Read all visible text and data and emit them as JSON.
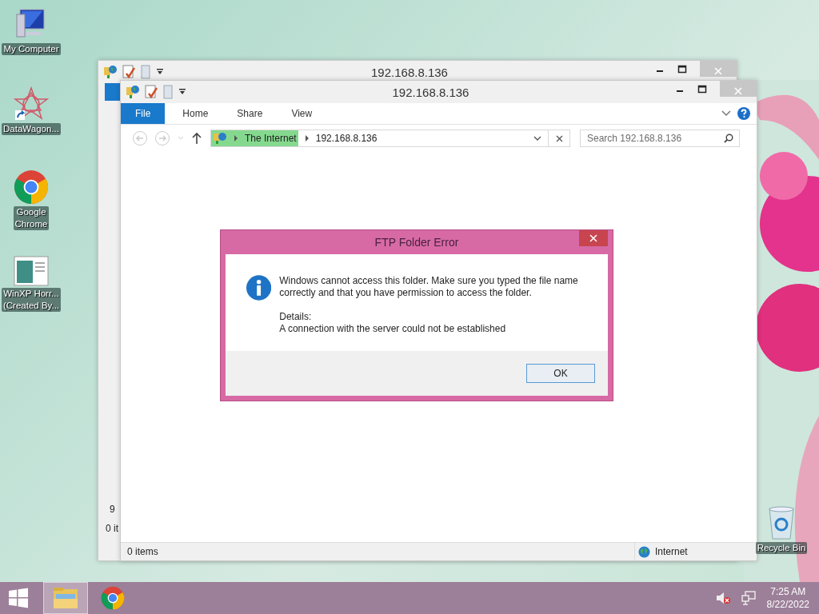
{
  "desktop_icons": [
    {
      "kind": "computer",
      "lines": [
        "My Computer"
      ]
    },
    {
      "kind": "star",
      "lines": [
        "DataWagon..."
      ]
    },
    {
      "kind": "chrome",
      "lines": [
        "Google",
        "Chrome"
      ]
    },
    {
      "kind": "document",
      "lines": [
        "WinXP Horr...",
        "(Created By..."
      ]
    }
  ],
  "recycle_bin": {
    "label": "Recycle Bin"
  },
  "back_window": {
    "title": "192.168.8.136",
    "text_1": "9",
    "status": "0 it"
  },
  "window": {
    "title": "192.168.8.136",
    "ribbon_tabs": [
      {
        "label": "File",
        "selected": true
      },
      {
        "label": "Home",
        "selected": false
      },
      {
        "label": "Share",
        "selected": false
      },
      {
        "label": "View",
        "selected": false
      }
    ],
    "breadcrumb": [
      "The Internet",
      "192.168.8.136"
    ],
    "search": {
      "placeholder": "Search 192.168.8.136"
    },
    "status_bar": {
      "items": "0 items",
      "zone": "Internet"
    }
  },
  "dialog": {
    "title": "FTP Folder Error",
    "message": "Windows cannot access this folder. Make sure you typed the file name correctly and that you have permission to access the folder.",
    "details_label": "Details:",
    "details": "A connection with the server could not be established",
    "buttons": [
      "OK"
    ]
  },
  "taskbar": {
    "apps": [
      {
        "kind": "explorer",
        "selected": true
      },
      {
        "kind": "chrome",
        "selected": false
      }
    ],
    "time": "7:25 AM",
    "date": "8/22/2022"
  }
}
